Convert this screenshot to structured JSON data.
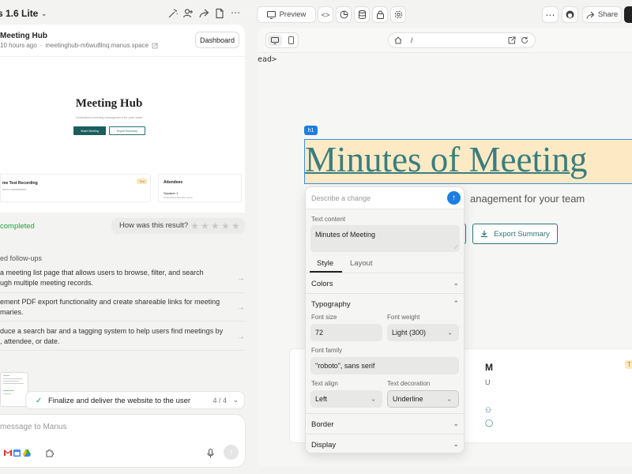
{
  "left": {
    "app_title": "s 1.6 Lite",
    "project": {
      "title": "Meeting Hub",
      "age": "10 hours ago",
      "url": "meetinghub-m6wu8lnq.manus.space",
      "dashboard_label": "Dashboard"
    },
    "preview": {
      "title": "Meeting Hub",
      "subtitle": "Centralized meeting management for your team",
      "share_label": "Share Meeting",
      "export_label": "Export Summary",
      "card1_title": "me Test Recording",
      "card1_sub": "been established",
      "card1_badge": "Test",
      "card2_title": "Attendees",
      "card2_person": "Speaker 1",
      "card2_role": "Unidentified (Female voice)"
    },
    "status": "completed",
    "rating_question": "How was this result?",
    "followups_heading": "ed follow-ups",
    "followups": [
      {
        "line1": "a meeting list page that allows users to browse, filter, and search",
        "line2": "ugh multiple meeting records."
      },
      {
        "line1": "ement PDF export functionality and create shareable links for meeting",
        "line2": "maries."
      },
      {
        "line1": "duce a search bar and a tagging system to help users find meetings by",
        "line2": ", attendee, or date."
      }
    ],
    "task": {
      "text": "Finalize and deliver the website to the user",
      "count": "4 / 4"
    },
    "composer_placeholder": "message to Manus"
  },
  "right": {
    "preview_label": "Preview",
    "share_label": "Share",
    "url_path": "/",
    "code_fragment": "ead>",
    "h1_tag": "h1",
    "h1_text": "Minutes of Meeting",
    "subtitle": "anagement for your team",
    "export_label": "Export Summary",
    "card_letter": "M",
    "card_letter2": "U",
    "card_badge": "T"
  },
  "editor": {
    "ask_placeholder": "Describe a change",
    "text_content_label": "Text content",
    "text_content_value": "Minutes of Meeting",
    "tabs": [
      "Style",
      "Layout"
    ],
    "colors_label": "Colors",
    "typography_label": "Typography",
    "font_size_label": "Font size",
    "font_size_value": "72",
    "font_weight_label": "Font weight",
    "font_weight_value": "Light (300)",
    "font_family_label": "Font family",
    "font_family_value": "\"roboto\", sans serif",
    "text_align_label": "Text align",
    "text_align_value": "Left",
    "text_decoration_label": "Text decoration",
    "text_decoration_value": "Underline",
    "border_label": "Border",
    "display_label": "Display"
  },
  "colors": {
    "accent": "#1a7fe0",
    "brand_teal": "#2c7575",
    "success": "#21a047",
    "highlight": "#fdeac5"
  }
}
